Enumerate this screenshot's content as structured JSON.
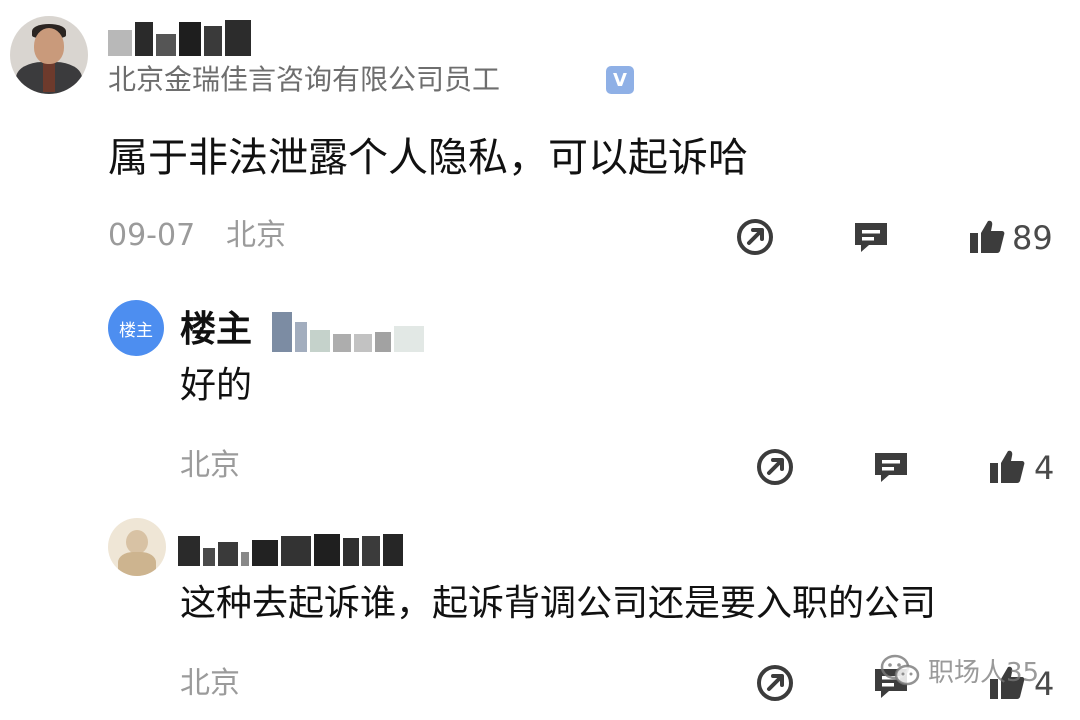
{
  "comment": {
    "company": "北京金瑞佳言咨询有限公司员工",
    "verified_badge": "V",
    "text": "属于非法泄露个人隐私，可以起诉哈",
    "date": "09-07",
    "location": "北京",
    "likes": "89"
  },
  "reply1": {
    "avatar_label": "楼主",
    "name": "楼主",
    "text": "好的",
    "location": "北京",
    "likes": "4"
  },
  "reply2": {
    "text": "这种去起诉谁，起诉背调公司还是要入职的公司",
    "location": "北京",
    "likes": "4"
  },
  "watermark": {
    "text": "职场人35"
  },
  "icons": {
    "share": "share-icon",
    "reply": "comment-icon",
    "like": "thumbs-up-icon",
    "wechat": "wechat-icon"
  },
  "colors": {
    "accent_blue": "#4d8ef0",
    "icon_gray": "#3c3c3c",
    "meta_gray": "#9b9b9b"
  }
}
